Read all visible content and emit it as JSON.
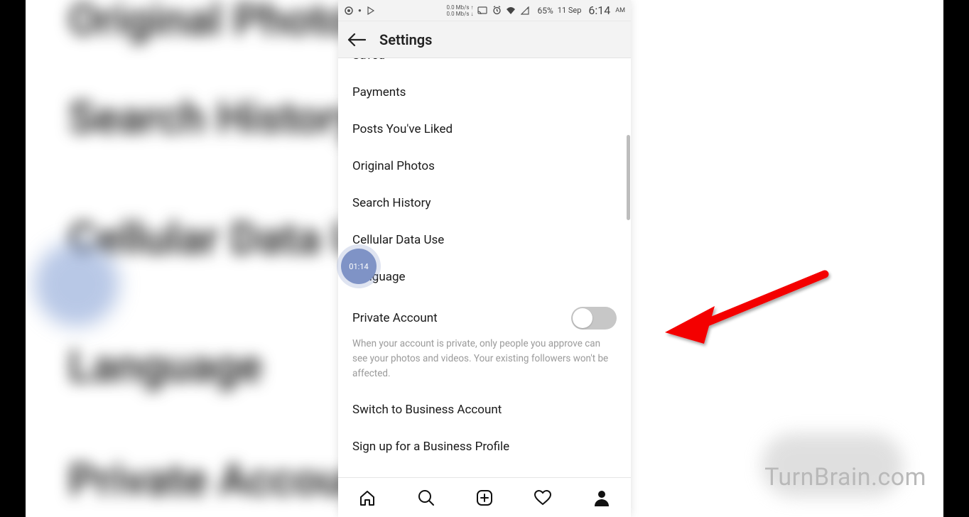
{
  "bg_blur": {
    "line1": "Original Photos",
    "line2": "Search History",
    "line3": "Cellular Data U",
    "line4": "Language",
    "line5": "Private Accoun"
  },
  "badge": {
    "time": "01:14"
  },
  "statusbar": {
    "net_upper": "0.0 Mb/s ↑",
    "net_lower": "0.0 Mb/s ↓",
    "battery": "65%",
    "date": "11 Sep",
    "time": "6:14",
    "ampm": "AM"
  },
  "header": {
    "title": "Settings"
  },
  "settings": {
    "items": [
      "Saved",
      "Payments",
      "Posts You've Liked",
      "Original Photos",
      "Search History",
      "Cellular Data Use",
      "Language"
    ],
    "private_account": {
      "label": "Private Account",
      "description": "When your account is private, only people you approve can see your photos and videos. Your existing followers won't be affected."
    },
    "after": [
      "Switch to Business Account",
      "Sign up for a Business Profile"
    ]
  },
  "watermark": "TurnBrain.com"
}
